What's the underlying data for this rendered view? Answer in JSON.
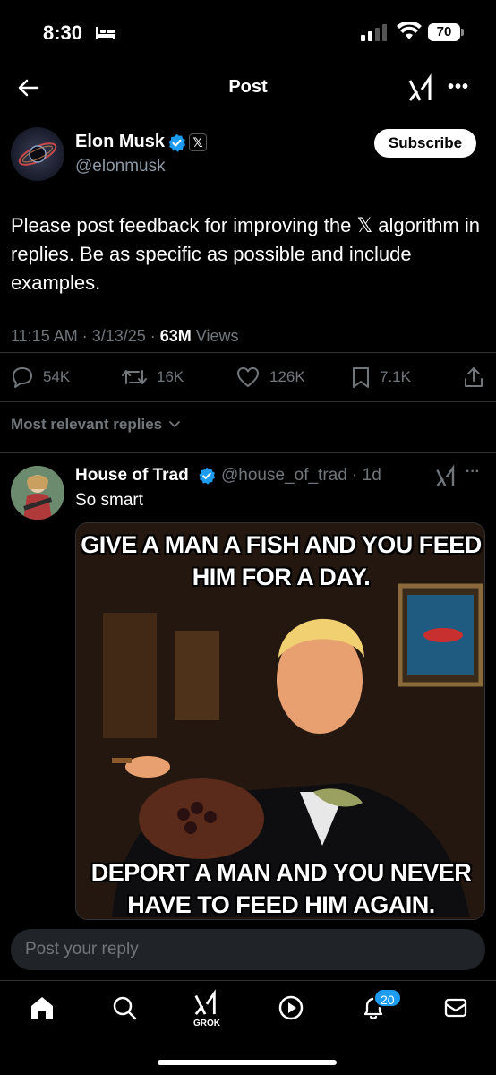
{
  "status_bar": {
    "time": "8:30",
    "battery": "70",
    "icons": [
      "bed-icon",
      "signal-icon",
      "wifi-icon",
      "battery-icon"
    ]
  },
  "header": {
    "title": "Post",
    "icons": [
      "back-arrow-icon",
      "grok-icon",
      "more-icon"
    ]
  },
  "post": {
    "author_name": "Elon Musk",
    "author_handle": "@elonmusk",
    "subscribe_label": "Subscribe",
    "text": "Please post feedback for improving the 𝕏 algorithm in replies. Be as specific as possible and include examples.",
    "time": "11:15 AM · 3/13/25 · ",
    "views_count": "63M",
    "views_label": " Views",
    "actions": {
      "replies": "54K",
      "reposts": "16K",
      "likes": "126K",
      "bookmarks": "7.1K"
    }
  },
  "replies_sort": "Most relevant replies",
  "reply": {
    "author_name": "House of Trad",
    "handle_time": "@house_of_trad · 1d",
    "text": "So smart",
    "meme_top": "GIVE A MAN A  FISH AND YOU FEED HIM FOR A DAY.",
    "meme_bottom": "DEPORT A MAN AND YOU NEVER HAVE TO FEED HIM AGAIN."
  },
  "composer": {
    "placeholder": "Post your reply"
  },
  "tabbar": {
    "grok_label": "GROK",
    "notifications_badge": "20",
    "tabs": [
      "home-icon",
      "search-icon",
      "grok-icon",
      "video-icon",
      "bell-icon",
      "mail-icon"
    ]
  },
  "colors": {
    "accent": "#1d9bf0",
    "background": "#000000",
    "secondary_text": "#71767b"
  }
}
